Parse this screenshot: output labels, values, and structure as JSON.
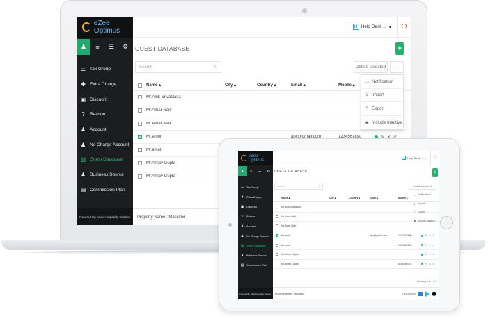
{
  "app": {
    "logo_text": "eZee Optimus"
  },
  "sidebar": {
    "icon_tabs": [
      "user-icon",
      "list-icon",
      "bed-icon",
      "gear-icon"
    ],
    "items": [
      {
        "label": "Tax Group",
        "icon": "list-icon"
      },
      {
        "label": "Extra Charge",
        "icon": "plus-circle-icon"
      },
      {
        "label": "Discount",
        "icon": "gift-icon"
      },
      {
        "label": "Reason",
        "icon": "question-circle-icon"
      },
      {
        "label": "Account",
        "icon": "person-icon"
      },
      {
        "label": "No Charge Account",
        "icon": "person-icon"
      },
      {
        "label": "Guest Database",
        "icon": "database-icon"
      },
      {
        "label": "Business Source",
        "icon": "users-icon"
      },
      {
        "label": "Commission Plan",
        "icon": "dollar-icon"
      }
    ],
    "footer": "Powered By: eZee Hospitality Solution"
  },
  "topbar": {
    "help_desk": "Help Desk ...",
    "help_icon": "H"
  },
  "page": {
    "title": "GUEST DATABASE",
    "add_label": "+",
    "search_placeholder": "Search",
    "delete_selected": "Delete selected",
    "more": "···"
  },
  "table": {
    "columns": [
      "Name ▴",
      "City ▴",
      "Country ▴",
      "Email ▴",
      "Mobile ▴"
    ],
    "rows": [
      {
        "name": "Mr.Alok Srivastava",
        "city": "",
        "country": "",
        "email": "",
        "mobile": "",
        "checked": false,
        "actions": false
      },
      {
        "name": "Mr.Amar Naik",
        "city": "",
        "country": "",
        "email": "",
        "mobile": "",
        "checked": false,
        "actions": false
      },
      {
        "name": "Mr.Amar Naik",
        "city": "",
        "country": "",
        "email": "",
        "mobile": "",
        "checked": false,
        "actions": false
      },
      {
        "name": "Mr.amol",
        "city": "",
        "country": "",
        "email": "abc@gmail.com",
        "mobile": "1234567890",
        "checked": true,
        "actions": true
      },
      {
        "name": "Mr.amol",
        "city": "",
        "country": "",
        "email": "",
        "mobile": "",
        "checked": false,
        "actions": false
      },
      {
        "name": "Mr.Arnav Gupta",
        "city": "",
        "country": "",
        "email": "",
        "mobile": "",
        "checked": false,
        "actions": false
      },
      {
        "name": "Mr.Arnav Gupta",
        "city": "",
        "country": "",
        "email": "",
        "mobile": "",
        "checked": false,
        "actions": false
      }
    ]
  },
  "tablet_table": {
    "rows": [
      {
        "name": "Mr.Alok Srivastava",
        "email": "",
        "mobile": "",
        "checked": false,
        "actions": false
      },
      {
        "name": "Mr.Amar Naik",
        "email": "",
        "mobile": "",
        "checked": false,
        "actions": false
      },
      {
        "name": "Mr.Amar Naik",
        "email": "",
        "mobile": "",
        "checked": false,
        "actions": false
      },
      {
        "name": "Mr.amol",
        "email": "abc@gmail.com",
        "mobile": "1234567890",
        "checked": true,
        "actions": true
      },
      {
        "name": "Mr.amol",
        "email": "",
        "mobile": "1234567890",
        "checked": false,
        "actions": true
      },
      {
        "name": "Mr.Arnav Gupta",
        "email": "",
        "mobile": "",
        "checked": false,
        "actions": true
      },
      {
        "name": "Mr.Arnav Gupta",
        "email": "",
        "mobile": "8236985742",
        "checked": false,
        "actions": true
      }
    ],
    "showing": "Showing 1 to 7 of 7",
    "footer_right": "Live Support"
  },
  "dropdown": [
    {
      "label": "Notification",
      "icon": "bell-icon",
      "glyph": "▭"
    },
    {
      "label": "Import",
      "icon": "import-icon",
      "glyph": "⤓"
    },
    {
      "label": "Export",
      "icon": "export-icon",
      "glyph": "⤒"
    },
    {
      "label": "Include Inactive",
      "icon": "eye-icon",
      "glyph": "◉"
    }
  ],
  "footer": {
    "property": "Property Name : Massimo"
  },
  "colors": {
    "accent": "#22b26d",
    "sidebar_bg": "#1b1d1f",
    "power": "#e0332c",
    "logo_text": "#62b6ea"
  }
}
